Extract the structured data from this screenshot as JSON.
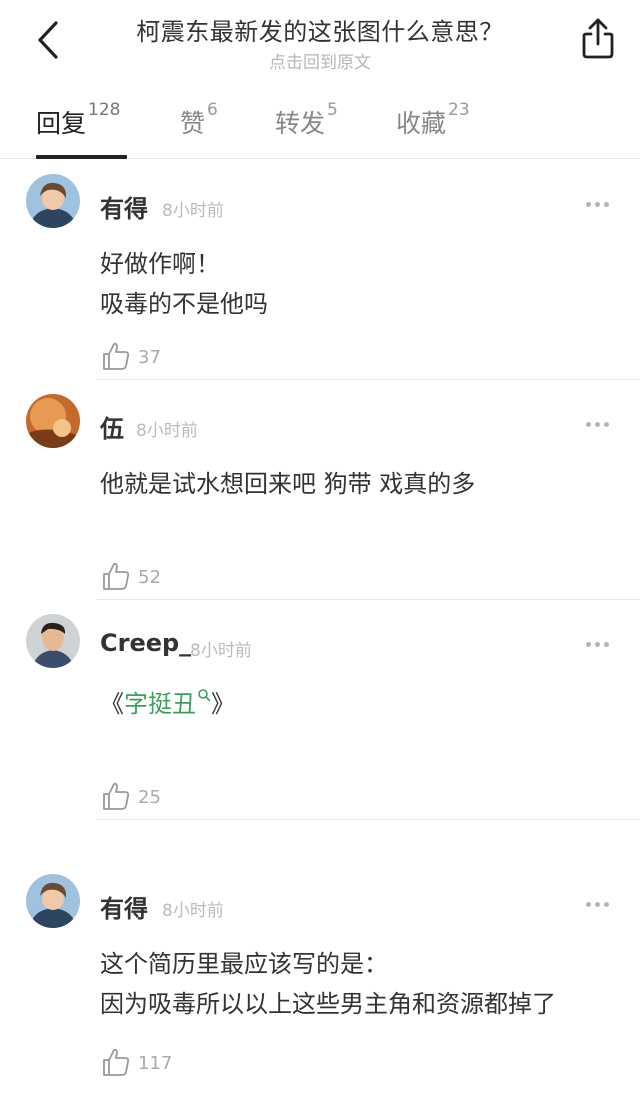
{
  "header": {
    "title": "柯震东最新发的这张图什么意思？",
    "subtitle": "点击回到原文",
    "back_icon": "chevron-left-icon",
    "share_icon": "share-icon"
  },
  "tabs": [
    {
      "label": "回复",
      "count": "128",
      "active": true
    },
    {
      "label": "赞",
      "count": "6",
      "active": false
    },
    {
      "label": "转发",
      "count": "5",
      "active": false
    },
    {
      "label": "收藏",
      "count": "23",
      "active": false
    }
  ],
  "comments": [
    {
      "user": "有得",
      "time": "8小时前",
      "lines": [
        "好做作啊！",
        "吸毒的不是他吗"
      ],
      "likes": "37",
      "avatar": "blue-hoodie-avatar"
    },
    {
      "user": "伍",
      "time": "8小时前",
      "lines": [
        "他就是试水想回来吧 狗带 戏真的多"
      ],
      "likes": "52",
      "avatar": "orange-photo-avatar"
    },
    {
      "user": "Creep_",
      "time": "8小时前",
      "text_prefix": "《",
      "link_text": "字挺丑",
      "text_suffix": "》",
      "likes": "25",
      "avatar": "portrait-avatar"
    },
    {
      "user": "有得",
      "time": "8小时前",
      "lines": [
        "这个简历里最应该写的是：",
        "因为吸毒所以以上这些男主角和资源都掉了"
      ],
      "likes": "117",
      "avatar": "blue-hoodie-avatar"
    }
  ],
  "colors": {
    "accent_link": "#3d9f5f",
    "muted": "#b7b7b7"
  }
}
